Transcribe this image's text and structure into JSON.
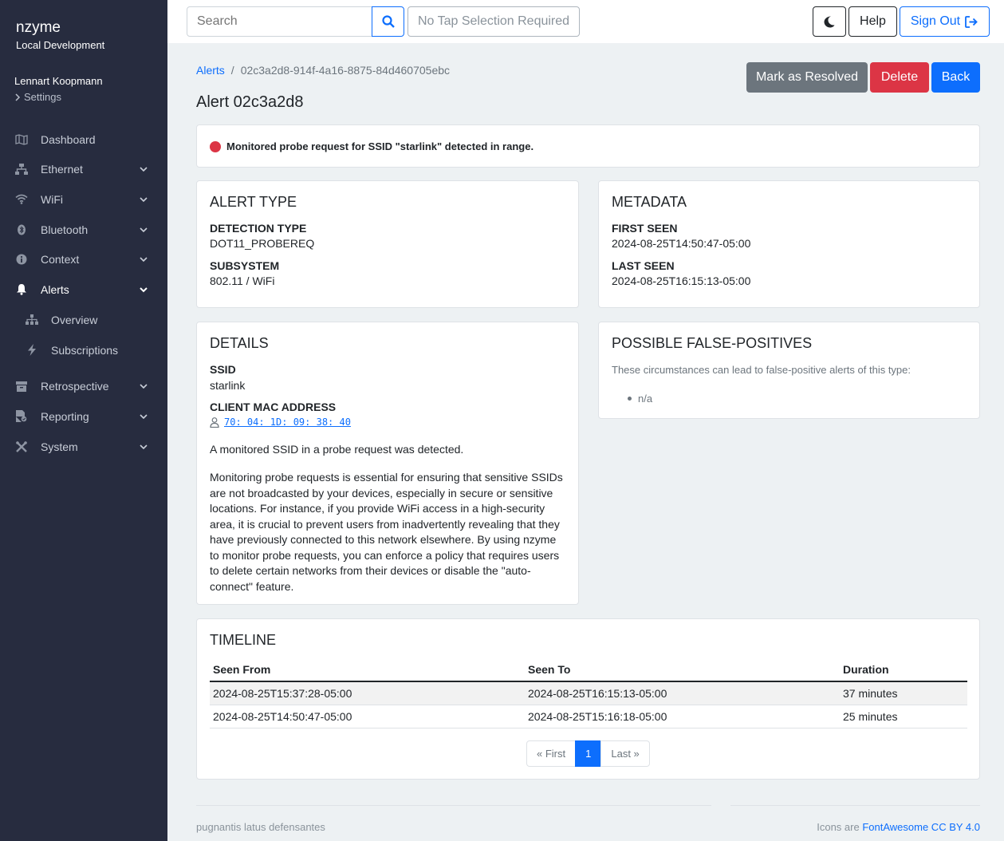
{
  "app": {
    "name": "nzyme",
    "environment": "Local Development"
  },
  "user": {
    "name": "Lennart Koopmann",
    "settings_label": "Settings"
  },
  "nav": {
    "items": [
      {
        "label": "Dashboard",
        "icon": "map-icon"
      },
      {
        "label": "Ethernet",
        "icon": "network-icon"
      },
      {
        "label": "WiFi",
        "icon": "wifi-icon"
      },
      {
        "label": "Bluetooth",
        "icon": "bluetooth-icon"
      },
      {
        "label": "Context",
        "icon": "info-icon"
      },
      {
        "label": "Alerts",
        "icon": "bell-icon"
      },
      {
        "label": "Retrospective",
        "icon": "archive-icon"
      },
      {
        "label": "Reporting",
        "icon": "report-icon"
      },
      {
        "label": "System",
        "icon": "tools-icon"
      }
    ],
    "alerts_sub": [
      {
        "label": "Overview",
        "icon": "sitemap-icon"
      },
      {
        "label": "Subscriptions",
        "icon": "bolt-icon"
      }
    ]
  },
  "topbar": {
    "search_placeholder": "Search",
    "tap_selection": "No Tap Selection Required",
    "help_label": "Help",
    "signout_label": "Sign Out"
  },
  "breadcrumb": {
    "parent": "Alerts",
    "separator": "/",
    "current": "02c3a2d8-914f-4a16-8875-84d460705ebc"
  },
  "page": {
    "title": "Alert 02c3a2d8"
  },
  "actions": {
    "resolve": "Mark as Resolved",
    "delete": "Delete",
    "back": "Back"
  },
  "status": {
    "message": "Monitored probe request for SSID \"starlink\" detected in range.",
    "color": "#dc3545"
  },
  "alert_type": {
    "title": "ALERT TYPE",
    "detection_type_label": "DETECTION TYPE",
    "detection_type": "DOT11_PROBEREQ",
    "subsystem_label": "SUBSYSTEM",
    "subsystem": "802.11 / WiFi"
  },
  "metadata": {
    "title": "METADATA",
    "first_seen_label": "FIRST SEEN",
    "first_seen": "2024-08-25T14:50:47-05:00",
    "last_seen_label": "LAST SEEN",
    "last_seen": "2024-08-25T16:15:13-05:00"
  },
  "details": {
    "title": "DETAILS",
    "ssid_label": "SSID",
    "ssid": "starlink",
    "mac_label": "CLIENT MAC ADDRESS",
    "mac": "70: 04: 1D: 09: 38: 40",
    "summary": "A monitored SSID in a probe request was detected.",
    "description": "Monitoring probe requests is essential for ensuring that sensitive SSIDs are not broadcasted by your devices, especially in secure or sensitive locations. For instance, if you provide WiFi access in a high-security area, it is crucial to prevent users from inadvertently revealing that they have previously connected to this network elsewhere. By using nzyme to monitor probe requests, you can enforce a policy that requires users to delete certain networks from their devices or disable the \"auto-connect\" feature."
  },
  "false_positives": {
    "title": "POSSIBLE FALSE-POSITIVES",
    "intro": "These circumstances can lead to false-positive alerts of this type:",
    "items": [
      "n/a"
    ]
  },
  "timeline": {
    "title": "TIMELINE",
    "columns": [
      "Seen From",
      "Seen To",
      "Duration"
    ],
    "rows": [
      [
        "2024-08-25T15:37:28-05:00",
        "2024-08-25T16:15:13-05:00",
        "37 minutes"
      ],
      [
        "2024-08-25T14:50:47-05:00",
        "2024-08-25T15:16:18-05:00",
        "25 minutes"
      ]
    ],
    "pagination": {
      "first": "« First",
      "current": "1",
      "last": "Last »"
    }
  },
  "footer": {
    "left": "pugnantis latus defensantes",
    "right_prefix": "Icons are",
    "right_link": "FontAwesome CC BY 4.0"
  }
}
